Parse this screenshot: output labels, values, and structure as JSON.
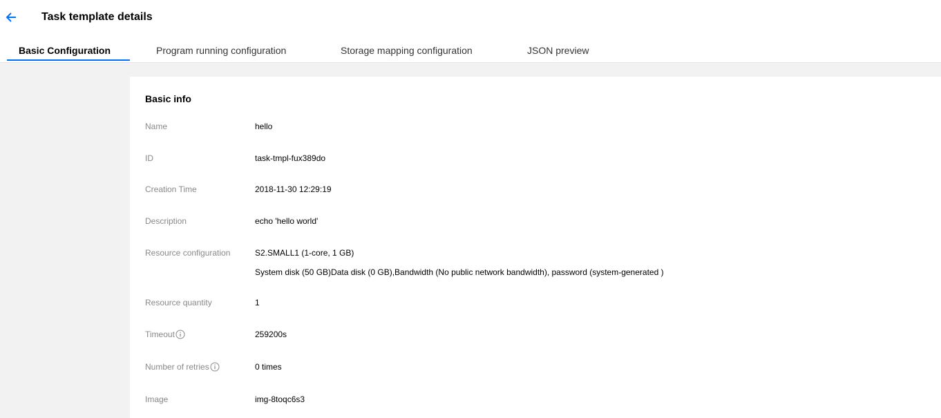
{
  "header": {
    "back_icon": "arrow-left-icon",
    "title": "Task template details",
    "accent_color": "#006eff"
  },
  "tabs": [
    {
      "label": "Basic Configuration",
      "active": true
    },
    {
      "label": "Program running configuration",
      "active": false
    },
    {
      "label": "Storage mapping configuration",
      "active": false
    },
    {
      "label": "JSON preview",
      "active": false
    }
  ],
  "basic_info": {
    "title": "Basic info",
    "rows": {
      "name": {
        "label": "Name",
        "value": "hello"
      },
      "id": {
        "label": "ID",
        "value": "task-tmpl-fux389do"
      },
      "creation_time": {
        "label": "Creation Time",
        "value": "2018-11-30 12:29:19"
      },
      "description": {
        "label": "Description",
        "value": "echo 'hello world'"
      },
      "resource_configuration": {
        "label": "Resource configuration",
        "value": "S2.SMALL1 (1-core, 1 GB)",
        "value_line2": "System disk (50 GB)Data disk (0 GB),Bandwidth (No public network bandwidth), password (system-generated )"
      },
      "resource_quantity": {
        "label": "Resource quantity",
        "value": "1"
      },
      "timeout": {
        "label": "Timeout",
        "value": "259200s",
        "icon": "info-circle-icon"
      },
      "retries": {
        "label": "Number of retries",
        "value": "0 times",
        "icon": "info-circle-icon"
      },
      "image": {
        "label": "Image",
        "value": "img-8toqc6s3"
      }
    }
  }
}
